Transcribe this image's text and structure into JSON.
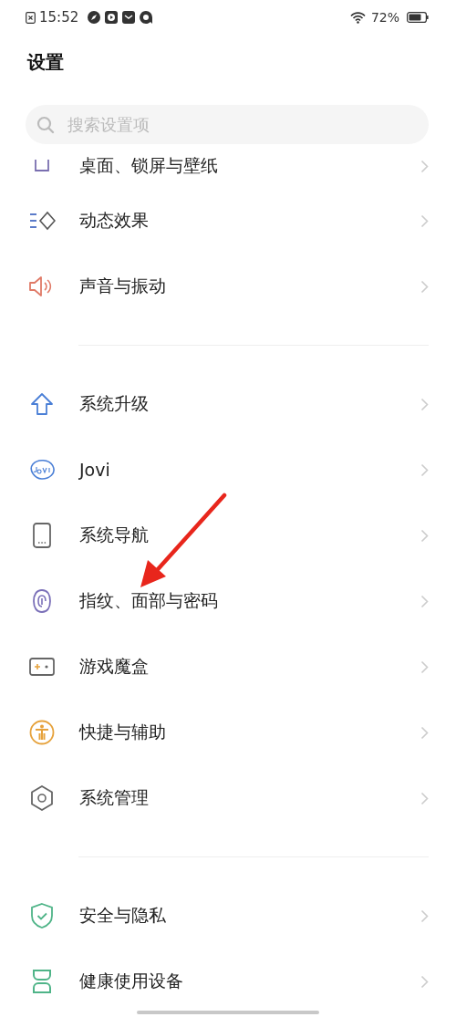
{
  "status_bar": {
    "time": "15:52",
    "battery": "72%"
  },
  "title": "设置",
  "search": {
    "placeholder": "搜索设置项"
  },
  "groups": [
    {
      "items": [
        {
          "label": "桌面、锁屏与壁纸"
        },
        {
          "label": "动态效果"
        },
        {
          "label": "声音与振动"
        }
      ]
    },
    {
      "items": [
        {
          "label": "系统升级"
        },
        {
          "label": "Jovi"
        },
        {
          "label": "系统导航"
        },
        {
          "label": "指纹、面部与密码"
        },
        {
          "label": "游戏魔盒"
        },
        {
          "label": "快捷与辅助"
        },
        {
          "label": "系统管理"
        }
      ]
    },
    {
      "items": [
        {
          "label": "安全与隐私"
        },
        {
          "label": "健康使用设备"
        }
      ]
    }
  ]
}
